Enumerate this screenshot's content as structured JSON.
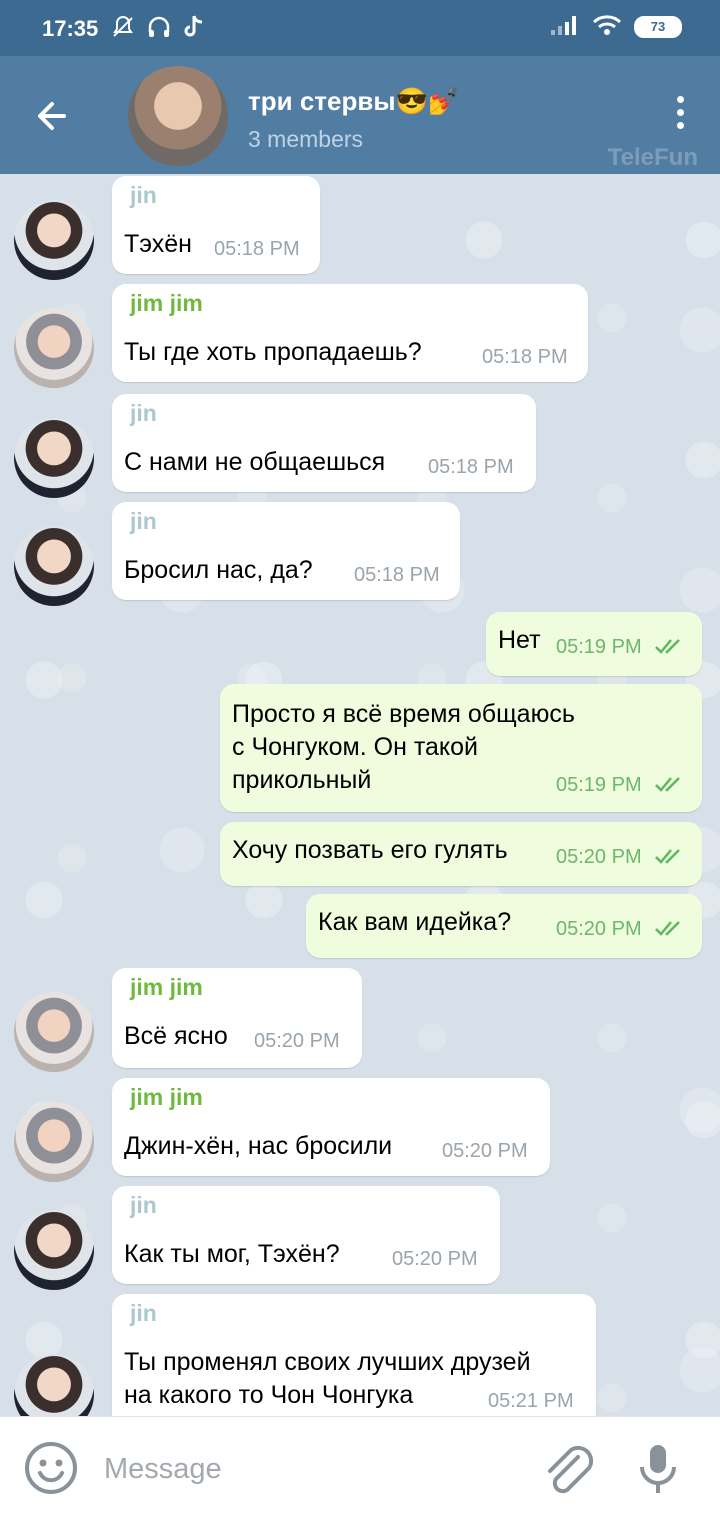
{
  "status_bar": {
    "time": "17:35",
    "battery": "73",
    "icons": [
      "mute-icon",
      "headset-icon",
      "tiktok-icon",
      "signal-icon",
      "wifi-icon",
      "battery-icon"
    ]
  },
  "header": {
    "title": "три стервы😎💅",
    "subtitle": "3 members",
    "watermark": "TeleFun"
  },
  "colors": {
    "header": "#517da2",
    "status_bar": "#3d6a91",
    "outgoing_bubble": "#effdde",
    "incoming_bubble": "#ffffff",
    "jin_name": "#a9c9cf",
    "jimjim_name": "#6fb93f"
  },
  "messages": [
    {
      "sender": "jin",
      "text": "Тэхён",
      "time": "05:18 PM"
    },
    {
      "sender": "jim jim",
      "text": "Ты где хоть пропадаешь?",
      "time": "05:18 PM"
    },
    {
      "sender": "jin",
      "text": "С нами не общаешься",
      "time": "05:18 PM"
    },
    {
      "sender": "jin",
      "text": "Бросил нас, да?",
      "time": "05:18 PM"
    },
    {
      "sender": "",
      "text": "Нет",
      "time": "05:19 PM"
    },
    {
      "sender": "",
      "text": "Просто я всё время общаюсь\nс Чонгуком. Он такой\nприкольный",
      "time": "05:19 PM"
    },
    {
      "sender": "",
      "text": "Хочу позвать его гулять",
      "time": "05:20 PM"
    },
    {
      "sender": "",
      "text": "Как вам идейка?",
      "time": "05:20 PM"
    },
    {
      "sender": "jim jim",
      "text": "Всё ясно",
      "time": "05:20 PM"
    },
    {
      "sender": "jim jim",
      "text": "Джин-хён, нас бросили",
      "time": "05:20 PM"
    },
    {
      "sender": "jin",
      "text": "Как ты мог, Тэхён?",
      "time": "05:20 PM"
    },
    {
      "sender": "jin",
      "text": "Ты променял своих лучших друзей\nна какого то Чон Чонгука",
      "time": "05:21 PM"
    }
  ],
  "input": {
    "placeholder": "Message"
  }
}
